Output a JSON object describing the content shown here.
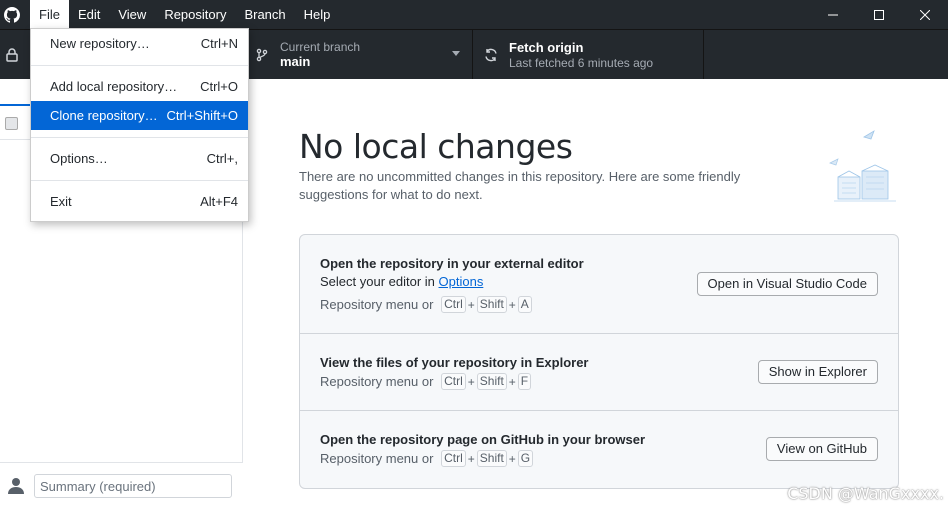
{
  "menubar": {
    "items": [
      "File",
      "Edit",
      "View",
      "Repository",
      "Branch",
      "Help"
    ],
    "active": "File"
  },
  "window_controls": {
    "minimize": "—",
    "maximize": "☐",
    "close": "✕"
  },
  "toolbar": {
    "branch_label": "Current branch",
    "branch_value": "main",
    "fetch_label": "Fetch origin",
    "fetch_sub": "Last fetched 6 minutes ago"
  },
  "file_menu": {
    "items": [
      {
        "label": "New repository…",
        "shortcut": "Ctrl+N"
      },
      {
        "label": "Add local repository…",
        "shortcut": "Ctrl+O"
      },
      {
        "label": "Clone repository…",
        "shortcut": "Ctrl+Shift+O"
      },
      {
        "label": "Options…",
        "shortcut": "Ctrl+,"
      },
      {
        "label": "Exit",
        "shortcut": "Alt+F4"
      }
    ],
    "selected_index": 2
  },
  "sidebar": {
    "summary_placeholder": "Summary (required)"
  },
  "main": {
    "title": "No local changes",
    "subtitle": "There are no uncommitted changes in this repository. Here are some friendly suggestions for what to do next.",
    "cards": [
      {
        "title": "Open the repository in your external editor",
        "desc_prefix": "Select your editor in ",
        "desc_link": "Options",
        "shortcut_prefix": "Repository menu or",
        "keys": [
          "Ctrl",
          "Shift",
          "A"
        ],
        "button": "Open in Visual Studio Code"
      },
      {
        "title": "View the files of your repository in Explorer",
        "shortcut_prefix": "Repository menu or",
        "keys": [
          "Ctrl",
          "Shift",
          "F"
        ],
        "button": "Show in Explorer"
      },
      {
        "title": "Open the repository page on GitHub in your browser",
        "shortcut_prefix": "Repository menu or",
        "keys": [
          "Ctrl",
          "Shift",
          "G"
        ],
        "button": "View on GitHub"
      }
    ]
  },
  "watermark": "CSDN @WanGxxxx.",
  "colors": {
    "titlebar": "#24292e",
    "accent": "#0366d6",
    "card_bg": "#f6f8fa"
  }
}
